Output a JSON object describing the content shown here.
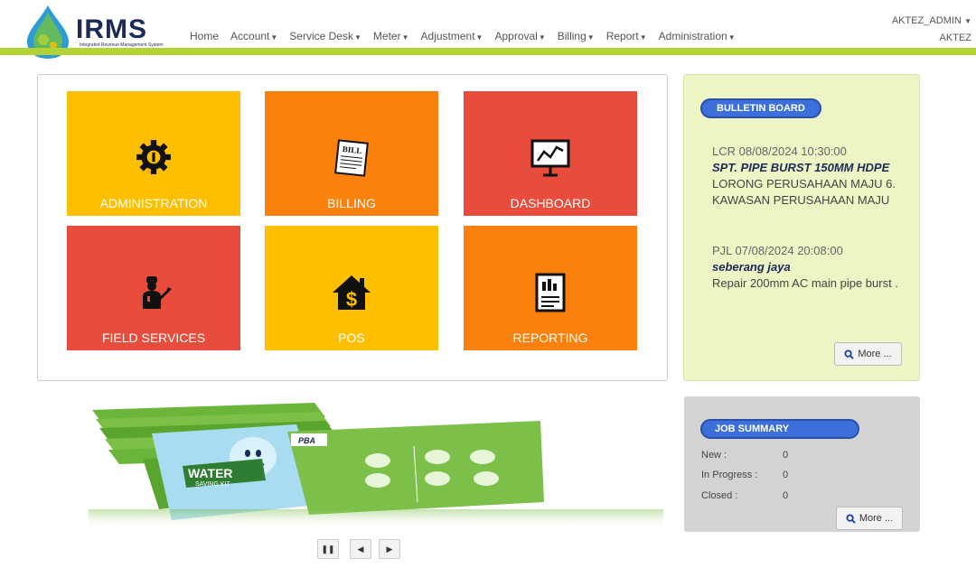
{
  "app": {
    "logo_text": "IRMS",
    "logo_subtitle": "Integrated Revenue Management System"
  },
  "nav": {
    "items": [
      {
        "label": "Home",
        "dropdown": false
      },
      {
        "label": "Account",
        "dropdown": true
      },
      {
        "label": "Service Desk",
        "dropdown": true
      },
      {
        "label": "Meter",
        "dropdown": true
      },
      {
        "label": "Adjustment",
        "dropdown": true
      },
      {
        "label": "Approval",
        "dropdown": true
      },
      {
        "label": "Billing",
        "dropdown": true
      },
      {
        "label": "Report",
        "dropdown": true
      },
      {
        "label": "Administration",
        "dropdown": true
      }
    ]
  },
  "user": {
    "username": "AKTEZ_ADMIN",
    "org": "AKTEZ"
  },
  "tiles": [
    {
      "label": "ADMINISTRATION",
      "icon": "gear-icon",
      "color": "#fdbf00"
    },
    {
      "label": "BILLING",
      "icon": "bill-icon",
      "color": "#fb810e"
    },
    {
      "label": "DASHBOARD",
      "icon": "dashboard-chart-icon",
      "color": "#e74c3c"
    },
    {
      "label": "FIELD SERVICES",
      "icon": "worker-icon",
      "color": "#e74c3c"
    },
    {
      "label": "POS",
      "icon": "house-dollar-icon",
      "color": "#fdbf00"
    },
    {
      "label": "REPORTING",
      "icon": "report-icon",
      "color": "#fb810e"
    }
  ],
  "bulletin": {
    "title": "BULLETIN BOARD",
    "items": [
      {
        "stamp": "LCR 08/08/2024 10:30:00",
        "headline": "SPT. PIPE BURST 150MM HDPE",
        "body": "LORONG PERUSAHAAN MAJU 6. KAWASAN PERUSAHAAN MAJU"
      },
      {
        "stamp": "PJL 07/08/2024 20:08:00",
        "headline": "seberang jaya",
        "body": "Repair 200mm AC main pipe burst ."
      }
    ],
    "more_label": "More ..."
  },
  "job_summary": {
    "title": "JOB SUMMARY",
    "rows": [
      {
        "label": "New :",
        "value": "0"
      },
      {
        "label": "In Progress :",
        "value": "0"
      },
      {
        "label": "Closed :",
        "value": "0"
      }
    ],
    "more_label": "More ..."
  },
  "banner": {
    "kit_title": "WATER",
    "kit_subtitle": "SAVING KIT",
    "brand": "PBA"
  },
  "slider": {
    "pause": "❚❚",
    "prev": "◀",
    "next": "▶"
  }
}
